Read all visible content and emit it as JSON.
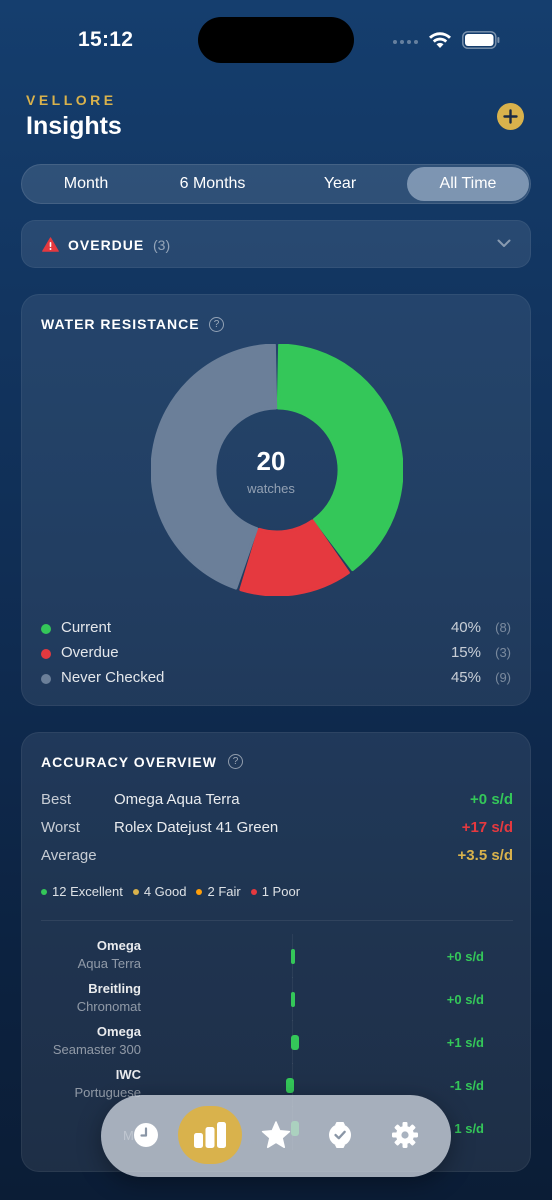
{
  "status_bar": {
    "time": "15:12"
  },
  "header": {
    "brand": "VELLORE",
    "title": "Insights"
  },
  "time_range": {
    "options": [
      "Month",
      "6 Months",
      "Year",
      "All Time"
    ],
    "selected": "All Time"
  },
  "overdue": {
    "label": "OVERDUE",
    "count": "(3)"
  },
  "water_resistance": {
    "title": "WATER RESISTANCE",
    "total": "20",
    "total_unit": "watches",
    "legend": [
      {
        "label": "Current",
        "percent": "40%",
        "count": "(8)",
        "color": "#34c759"
      },
      {
        "label": "Overdue",
        "percent": "15%",
        "count": "(3)",
        "color": "#e5393f"
      },
      {
        "label": "Never Checked",
        "percent": "45%",
        "count": "(9)",
        "color": "#6b7f99"
      }
    ]
  },
  "chart_data": {
    "type": "pie",
    "categories": [
      "Current",
      "Overdue",
      "Never Checked"
    ],
    "values": [
      8,
      3,
      9
    ],
    "percents": [
      40,
      15,
      45
    ],
    "colors": [
      "#34c759",
      "#e5393f",
      "#6b7f99"
    ],
    "title": "WATER RESISTANCE",
    "donut": true
  },
  "accuracy": {
    "title": "ACCURACY OVERVIEW",
    "best": {
      "key": "Best",
      "name": "Omega Aqua Terra",
      "value": "+0 s/d"
    },
    "worst": {
      "key": "Worst",
      "name": "Rolex Datejust 41 Green",
      "value": "+17 s/d"
    },
    "average": {
      "key": "Average",
      "value": "+3.5 s/d"
    },
    "counts": [
      {
        "label": "12 Excellent",
        "color": "#34c759"
      },
      {
        "label": "4 Good",
        "color": "#d9b24c"
      },
      {
        "label": "2 Fair",
        "color": "#ff9f0a"
      },
      {
        "label": "1 Poor",
        "color": "#e5393f"
      }
    ],
    "bars": [
      {
        "brand": "Omega",
        "model": "Aqua Terra",
        "deviation": 0,
        "value": "+0 s/d"
      },
      {
        "brand": "Breitling",
        "model": "Chronomat",
        "deviation": 0,
        "value": "+0 s/d"
      },
      {
        "brand": "Omega",
        "model": "Seamaster 300",
        "deviation": 1,
        "value": "+1 s/d"
      },
      {
        "brand": "IWC",
        "model": "Portuguese",
        "deviation": -1,
        "value": "-1 s/d"
      },
      {
        "brand": "",
        "model": "Ma",
        "deviation": 1,
        "value": "1 s/d"
      }
    ]
  },
  "tab_bar": {
    "tabs": [
      {
        "icon": "clock-icon",
        "active": false
      },
      {
        "icon": "bar-chart-icon",
        "active": true
      },
      {
        "icon": "star-icon",
        "active": false
      },
      {
        "icon": "watch-icon",
        "active": false
      },
      {
        "icon": "gear-icon",
        "active": false
      }
    ]
  }
}
